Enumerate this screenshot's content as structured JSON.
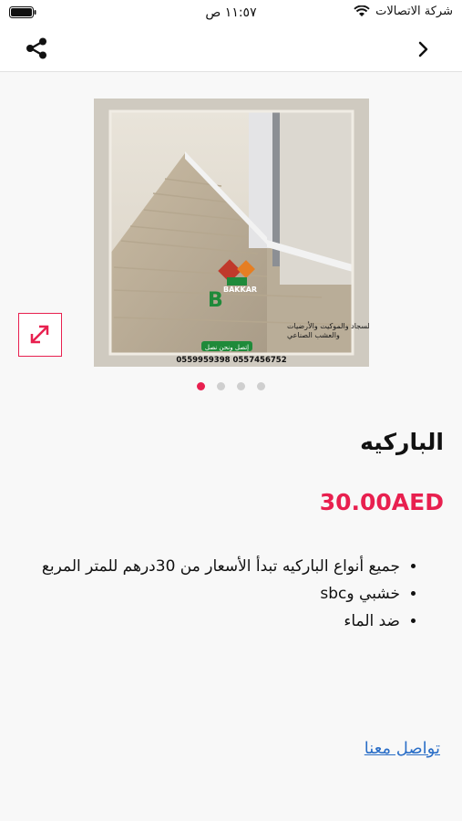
{
  "status_bar": {
    "time": "١١:٥٧ ص",
    "carrier": "شركة الاتصالات",
    "battery_icon": "battery-icon",
    "wifi_icon": "wifi-icon"
  },
  "nav": {
    "share_icon": "share-icon",
    "back_icon": "chevron-right-icon"
  },
  "product": {
    "image_overlay": {
      "brand": "BAKKAR",
      "line1": "السجاد والموكيت والأرضيات",
      "line2": "والعشب الصناعي",
      "call_badge": "إتصل ونحن نصل",
      "phones": "0559959398  0557456752"
    },
    "title": "الباركيه",
    "price": "30.00AED",
    "description": [
      "جميع أنواع الباركيه تبدأ الأسعار من 30درهم للمتر المربع",
      "خشبي وsbc",
      "ضد الماء"
    ],
    "contact_label": "تواصل معنا"
  },
  "gallery": {
    "page_count": 4,
    "active_index": 0
  },
  "colors": {
    "accent": "#e8204f",
    "link": "#2a6ec7",
    "background": "#f8f8f8"
  }
}
